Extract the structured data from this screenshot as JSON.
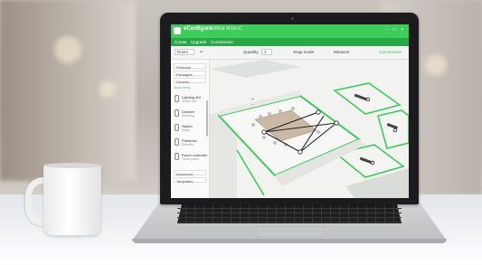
{
  "app": {
    "name": "eConfigure",
    "document_title": "Office R19-C",
    "window_controls": "– □ ×"
  },
  "menu": {
    "items": [
      "Create",
      "Upgrade",
      "Commission"
    ]
  },
  "toolbar": {
    "undo_label": "↶",
    "room_label": "Room",
    "quantity_label": "Quantity",
    "quantity_value": "1",
    "snap_label": "Snap mode",
    "measure_label": "Measure",
    "export_label": "Commission"
  },
  "sidebar": {
    "filters": [
      "Products",
      "Packages",
      "Devices"
    ],
    "section_label": "Show Items",
    "items": [
      {
        "title": "Lighting 4M",
        "sub": "Switch 4M"
      },
      {
        "title": "Dimmer",
        "sub": "Dimming"
      },
      {
        "title": "Switch",
        "sub": "Relay"
      },
      {
        "title": "Presence",
        "sub": "Detector"
      },
      {
        "title": "Room controller",
        "sub": "Touch panel"
      }
    ],
    "footer_fields": [
      "Advanced",
      "Templates"
    ]
  },
  "floorplan": {
    "zoom_in": "+",
    "zoom_out": "−",
    "accent": "#3dcd58"
  },
  "icons": {
    "logo": "econfigure-logo",
    "coffee_mug": "mug",
    "device": "sensor-icon"
  }
}
